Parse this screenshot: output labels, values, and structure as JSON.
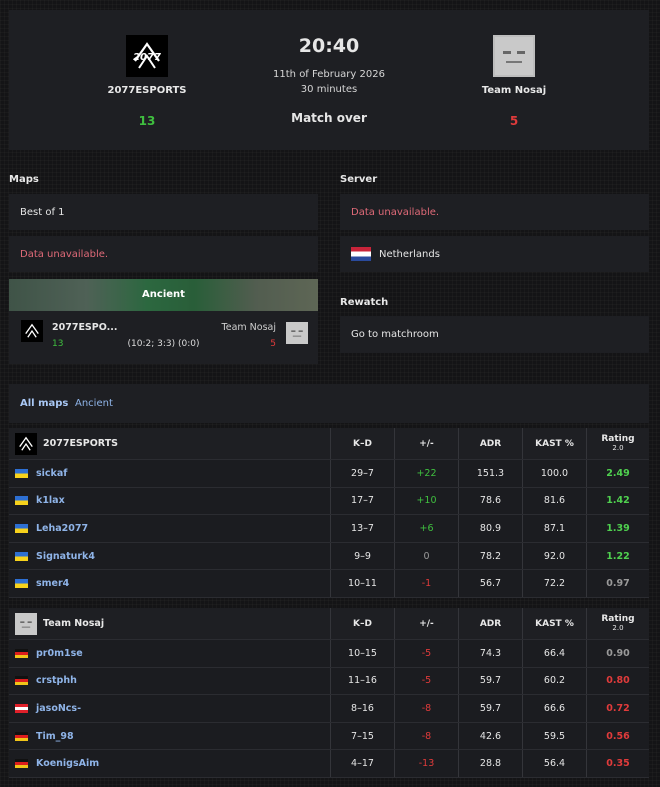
{
  "match": {
    "time": "20:40",
    "date": "11th of February 2026",
    "duration": "30 minutes",
    "status": "Match over"
  },
  "team1": {
    "name": "2077ESPORTS",
    "score": "13",
    "logo_icon": "2077esports-logo"
  },
  "team2": {
    "name": "Team Nosaj",
    "score": "5",
    "logo_icon": "team-nosaj-avatar"
  },
  "maps": {
    "title": "Maps",
    "format": "Best of 1",
    "error": "Data unavailable.",
    "card": {
      "map": "Ancient",
      "team1": "2077ESPO...",
      "team1_score": "13",
      "team2": "Team Nosaj",
      "team2_score": "5",
      "rounds": "(10:2; 3:3) (0:0)"
    }
  },
  "server": {
    "title": "Server",
    "error": "Data unavailable.",
    "country": "Netherlands"
  },
  "rewatch": {
    "title": "Rewatch",
    "link": "Go to matchroom"
  },
  "tabs": [
    "All maps",
    "Ancient"
  ],
  "columns": {
    "kd": "K–D",
    "pm": "+/-",
    "adr": "ADR",
    "kast": "KAST %",
    "rating": "Rating",
    "rating_sub": "2.0"
  },
  "team1_players": [
    {
      "name": "sickaf",
      "flag": "ua",
      "kd": "29–7",
      "pm": "+22",
      "adr": "151.3",
      "kast": "100.0",
      "rating": "2.49"
    },
    {
      "name": "k1lax",
      "flag": "ua",
      "kd": "17–7",
      "pm": "+10",
      "adr": "78.6",
      "kast": "81.6",
      "rating": "1.42"
    },
    {
      "name": "Leha2077",
      "flag": "ua",
      "kd": "13–7",
      "pm": "+6",
      "adr": "80.9",
      "kast": "87.1",
      "rating": "1.39"
    },
    {
      "name": "Signaturk4",
      "flag": "ua",
      "kd": "9–9",
      "pm": "0",
      "adr": "78.2",
      "kast": "92.0",
      "rating": "1.22"
    },
    {
      "name": "smer4",
      "flag": "ua",
      "kd": "10–11",
      "pm": "-1",
      "adr": "56.7",
      "kast": "72.2",
      "rating": "0.97"
    }
  ],
  "team2_players": [
    {
      "name": "pr0m1se",
      "flag": "de",
      "kd": "10–15",
      "pm": "-5",
      "adr": "74.3",
      "kast": "66.4",
      "rating": "0.90"
    },
    {
      "name": "crstphh",
      "flag": "de",
      "kd": "11–16",
      "pm": "-5",
      "adr": "59.7",
      "kast": "60.2",
      "rating": "0.80"
    },
    {
      "name": "jasoNcs-",
      "flag": "at",
      "kd": "8–16",
      "pm": "-8",
      "adr": "59.7",
      "kast": "66.6",
      "rating": "0.72"
    },
    {
      "name": "Tim_98",
      "flag": "de",
      "kd": "7–15",
      "pm": "-8",
      "adr": "42.6",
      "kast": "59.5",
      "rating": "0.56"
    },
    {
      "name": "KoenigsAim",
      "flag": "de",
      "kd": "4–17",
      "pm": "-13",
      "adr": "28.8",
      "kast": "56.4",
      "rating": "0.35"
    }
  ]
}
